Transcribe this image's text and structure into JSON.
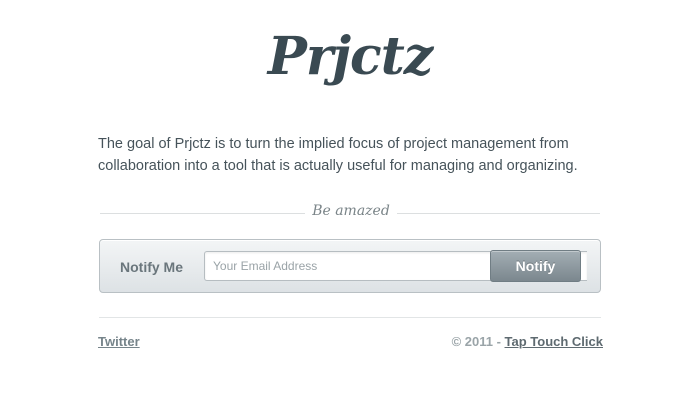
{
  "header": {
    "logo_text": "Prjctz"
  },
  "intro": {
    "text": "The goal of Prjctz is to turn the implied focus of project management from collaboration into a tool that is actually useful for managing and organizing."
  },
  "divider": {
    "label": "Be amazed"
  },
  "signup": {
    "label": "Notify Me",
    "email_placeholder": "Your Email Address",
    "email_value": "",
    "button_label": "Notify"
  },
  "footer": {
    "twitter_label": "Twitter",
    "copyright_prefix": "© 2011 - ",
    "credit_link": "Tap Touch Click"
  },
  "colors": {
    "text": "#3d4a50",
    "button": "#7b878e",
    "panel": "#e5e9eb"
  }
}
